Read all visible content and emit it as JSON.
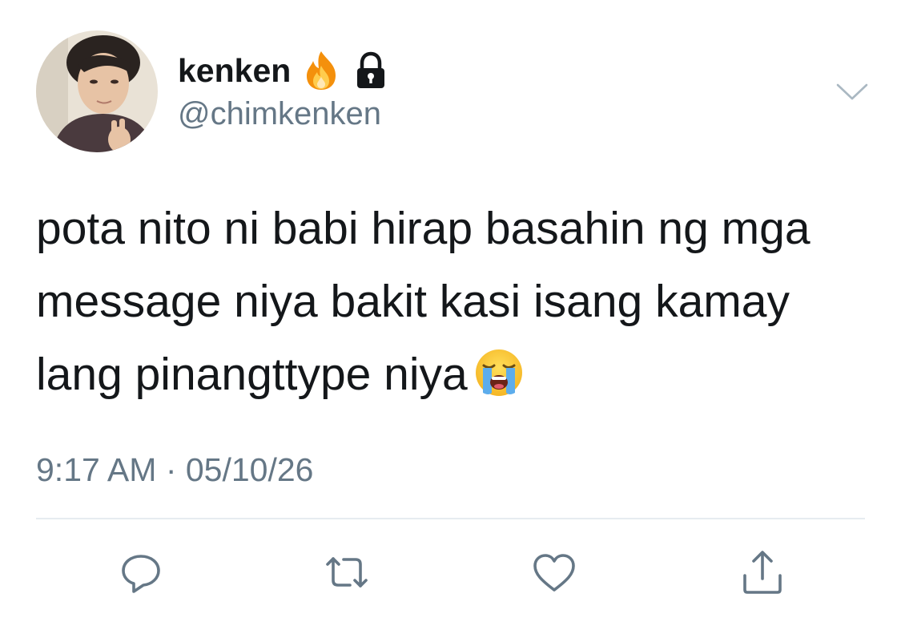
{
  "tweet": {
    "display_name": "kenken",
    "handle": "@chimkenken",
    "name_icons": [
      "fire-emoji",
      "lock-icon"
    ],
    "text_line_1": "pota nito ni babi hirap basahin ng mga",
    "text_line_2": "message niya bakit kasi isang kamay",
    "text_line_3": "lang pinangttype niya",
    "trailing_emoji": "loudly-crying-face-emoji",
    "timestamp": "9:17 AM · 05/10/26"
  },
  "actions": [
    "reply-icon",
    "retweet-icon",
    "like-icon",
    "share-icon"
  ],
  "colors": {
    "text": "#14171a",
    "secondary": "#657786",
    "divider": "#e6ecf0",
    "icon": "#657786"
  }
}
